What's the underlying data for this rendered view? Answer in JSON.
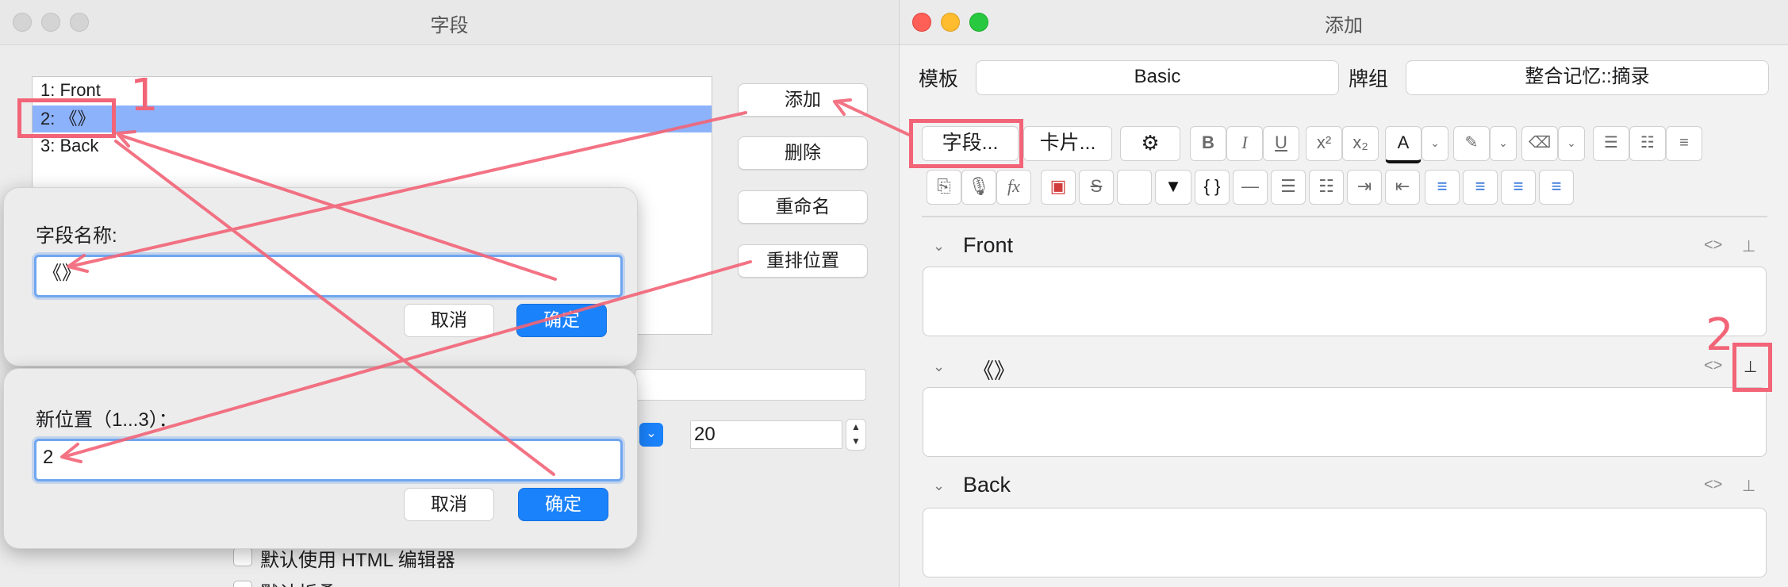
{
  "left_window": {
    "title": "字段",
    "fields": [
      "1: Front",
      "2: 《》",
      "3: Back"
    ],
    "buttons": {
      "add": "添加",
      "delete": "删除",
      "rename": "重命名",
      "reposition": "重排位置"
    },
    "font_size_value": "20",
    "checkboxes": [
      "默认使用 HTML 编辑器",
      "默认折叠"
    ]
  },
  "rename_dialog": {
    "label": "字段名称:",
    "value": "《》",
    "cancel": "取消",
    "ok": "确定"
  },
  "reposition_dialog": {
    "label": "新位置（1...3）：",
    "value": "2",
    "cancel": "取消",
    "ok": "确定"
  },
  "right_window": {
    "title": "添加",
    "model_label": "模板",
    "model_value": "Basic",
    "deck_label": "牌组",
    "deck_value": "整合记忆::摘录",
    "fields_button": "字段...",
    "cards_button": "卡片...",
    "toolbar": {
      "bold": "B",
      "italic": "I",
      "underline": "U",
      "superscript": "x²",
      "subscript": "x₂",
      "text_color": "A",
      "formula": "fx",
      "cloze": "{ }"
    },
    "sections": [
      {
        "name": "Front",
        "pinned": false
      },
      {
        "name": "《》",
        "pinned": true
      },
      {
        "name": "Back",
        "pinned": false
      }
    ],
    "html_toggle": "<>"
  },
  "annotations": {
    "step1": "1",
    "step2": "2",
    "color": "#f26477"
  },
  "colors": {
    "selection": "#8cb2fb",
    "primary_button": "#1a82fb",
    "annotation": "#f26477"
  }
}
